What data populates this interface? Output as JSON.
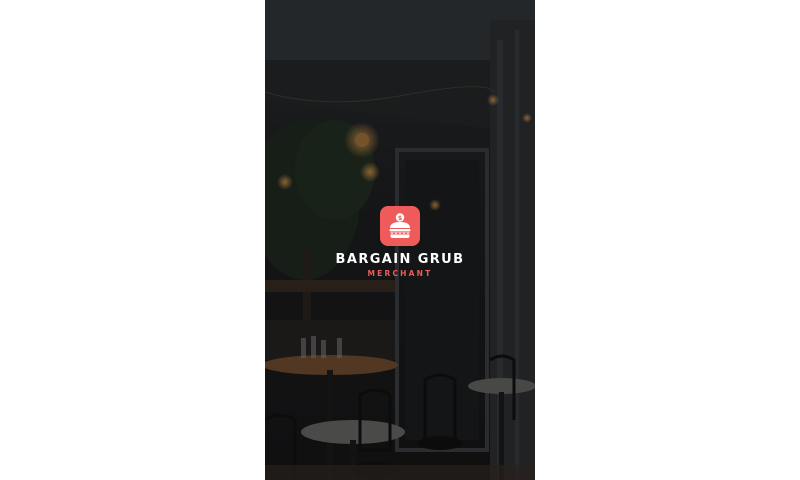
{
  "app": {
    "name": "BARGAIN GRUB",
    "subtitle": "MERCHANT",
    "logo_icon": "burger-dollar-icon"
  },
  "colors": {
    "accent": "#ef5b5b",
    "text": "#ffffff",
    "overlay": "#0a0a0c"
  },
  "background": {
    "scene": "restaurant-terrace-photo"
  }
}
